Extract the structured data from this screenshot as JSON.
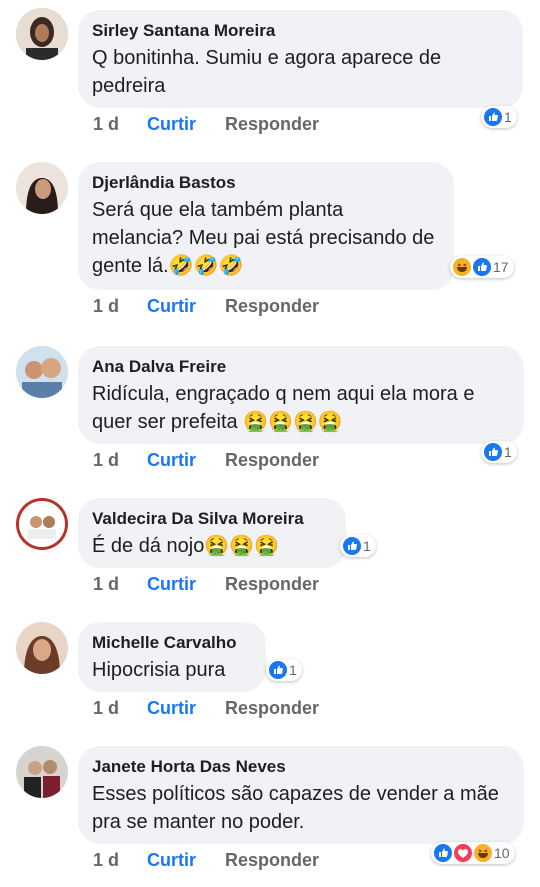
{
  "comments": [
    {
      "author": "Sirley Santana Moreira",
      "text": "Q bonitinha. Sumiu e agora aparece de pedreira",
      "emoji": "",
      "time": "1 d",
      "like": "Curtir",
      "reply": "Responder",
      "reactions": [
        "like"
      ],
      "count": "1"
    },
    {
      "author": "Djerlândia Bastos",
      "text": "Será que ela também planta melancia? Meu pai está precisando de gente lá.",
      "emoji": "🤣🤣🤣",
      "time": "1 d",
      "like": "Curtir",
      "reply": "Responder",
      "reactions": [
        "haha",
        "like"
      ],
      "count": "17"
    },
    {
      "author": "Ana Dalva Freire",
      "text": "Ridícula, engraçado q nem aqui ela mora e quer ser prefeita",
      "emoji": "🤮🤮🤮🤮",
      "time": "1 d",
      "like": "Curtir",
      "reply": "Responder",
      "reactions": [
        "like"
      ],
      "count": "1"
    },
    {
      "author": "Valdecira Da Silva Moreira",
      "text": "É de dá nojo",
      "emoji": "🤮🤮🤮",
      "time": "1 d",
      "like": "Curtir",
      "reply": "Responder",
      "reactions": [
        "like"
      ],
      "count": "1"
    },
    {
      "author": "Michelle Carvalho",
      "text": "Hipocrisia pura",
      "emoji": "",
      "time": "1 d",
      "like": "Curtir",
      "reply": "Responder",
      "reactions": [
        "like"
      ],
      "count": "1"
    },
    {
      "author": "Janete Horta Das Neves",
      "text": "Esses políticos são  capazes de vender a mãe  pra se manter no poder.",
      "emoji": "",
      "time": "1 d",
      "like": "Curtir",
      "reply": "Responder",
      "reactions": [
        "like",
        "love",
        "haha"
      ],
      "count": "10"
    }
  ],
  "colors": {
    "like": "#1877f2",
    "love": "#f33e58",
    "haha": "#f7b125",
    "bubble": "#f0f2f5",
    "meta": "#65676b"
  }
}
